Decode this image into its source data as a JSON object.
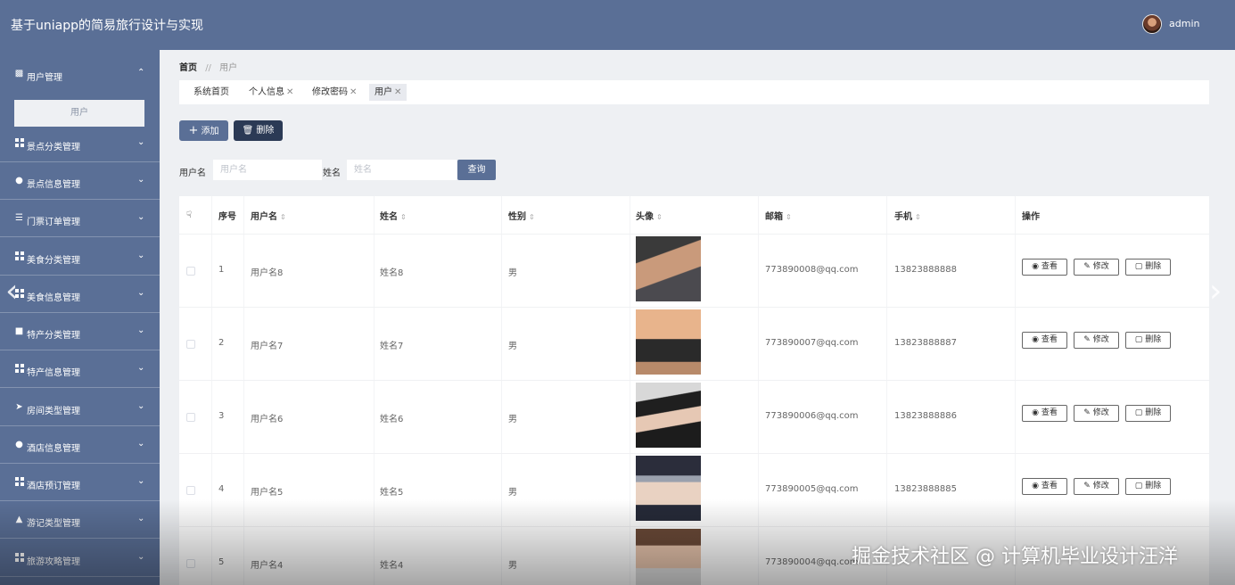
{
  "header": {
    "app_title": "基于uniapp的简易旅行设计与实现",
    "user_name": "admin"
  },
  "sidebar": {
    "items": [
      {
        "label": "用户管理",
        "icon": "briefcase-icon",
        "expanded": true
      },
      {
        "label": "景点分类管理",
        "icon": "grid-icon"
      },
      {
        "label": "景点信息管理",
        "icon": "pin-icon"
      },
      {
        "label": "门票订单管理",
        "icon": "sliders-icon"
      },
      {
        "label": "美食分类管理",
        "icon": "grid-icon"
      },
      {
        "label": "美食信息管理",
        "icon": "grid-icon"
      },
      {
        "label": "特产分类管理",
        "icon": "box-icon"
      },
      {
        "label": "特产信息管理",
        "icon": "grid-icon"
      },
      {
        "label": "房间类型管理",
        "icon": "send-icon"
      },
      {
        "label": "酒店信息管理",
        "icon": "user-icon"
      },
      {
        "label": "酒店预订管理",
        "icon": "grid-icon"
      },
      {
        "label": "游记类型管理",
        "icon": "chart-icon"
      },
      {
        "label": "旅游攻略管理",
        "icon": "grid-icon"
      }
    ],
    "sub_item": "用户"
  },
  "breadcrumb": {
    "home": "首页",
    "separator": "//",
    "current": "用户"
  },
  "tabs": [
    {
      "label": "系统首页",
      "closable": false
    },
    {
      "label": "个人信息",
      "closable": true
    },
    {
      "label": "修改密码",
      "closable": true
    },
    {
      "label": "用户",
      "closable": true,
      "active": true
    }
  ],
  "toolbar": {
    "add_label": "添加",
    "delete_label": "删除"
  },
  "search": {
    "username_label": "用户名",
    "username_placeholder": "用户名",
    "name_label": "姓名",
    "name_placeholder": "姓名",
    "query_label": "查询"
  },
  "table": {
    "headers": {
      "index": "序号",
      "username": "用户名",
      "name": "姓名",
      "gender": "性别",
      "avatar": "头像",
      "email": "邮箱",
      "phone": "手机",
      "actions": "操作"
    },
    "action_labels": {
      "view": "查看",
      "edit": "修改",
      "delete": "删除"
    },
    "rows": [
      {
        "index": "1",
        "username": "用户名8",
        "name": "姓名8",
        "gender": "男",
        "email": "773890008@qq.com",
        "phone": "13823888888"
      },
      {
        "index": "2",
        "username": "用户名7",
        "name": "姓名7",
        "gender": "男",
        "email": "773890007@qq.com",
        "phone": "13823888887"
      },
      {
        "index": "3",
        "username": "用户名6",
        "name": "姓名6",
        "gender": "男",
        "email": "773890006@qq.com",
        "phone": "13823888886"
      },
      {
        "index": "4",
        "username": "用户名5",
        "name": "姓名5",
        "gender": "男",
        "email": "773890005@qq.com",
        "phone": "13823888885"
      },
      {
        "index": "5",
        "username": "用户名4",
        "name": "姓名4",
        "gender": "男",
        "email": "773890004@qq.com",
        "phone": ""
      }
    ]
  },
  "watermark": "掘金技术社区 @ 计算机毕业设计汪洋",
  "colors": {
    "primary": "#5a6f96",
    "dark_button": "#2b3a55",
    "background": "#eef0f3"
  }
}
